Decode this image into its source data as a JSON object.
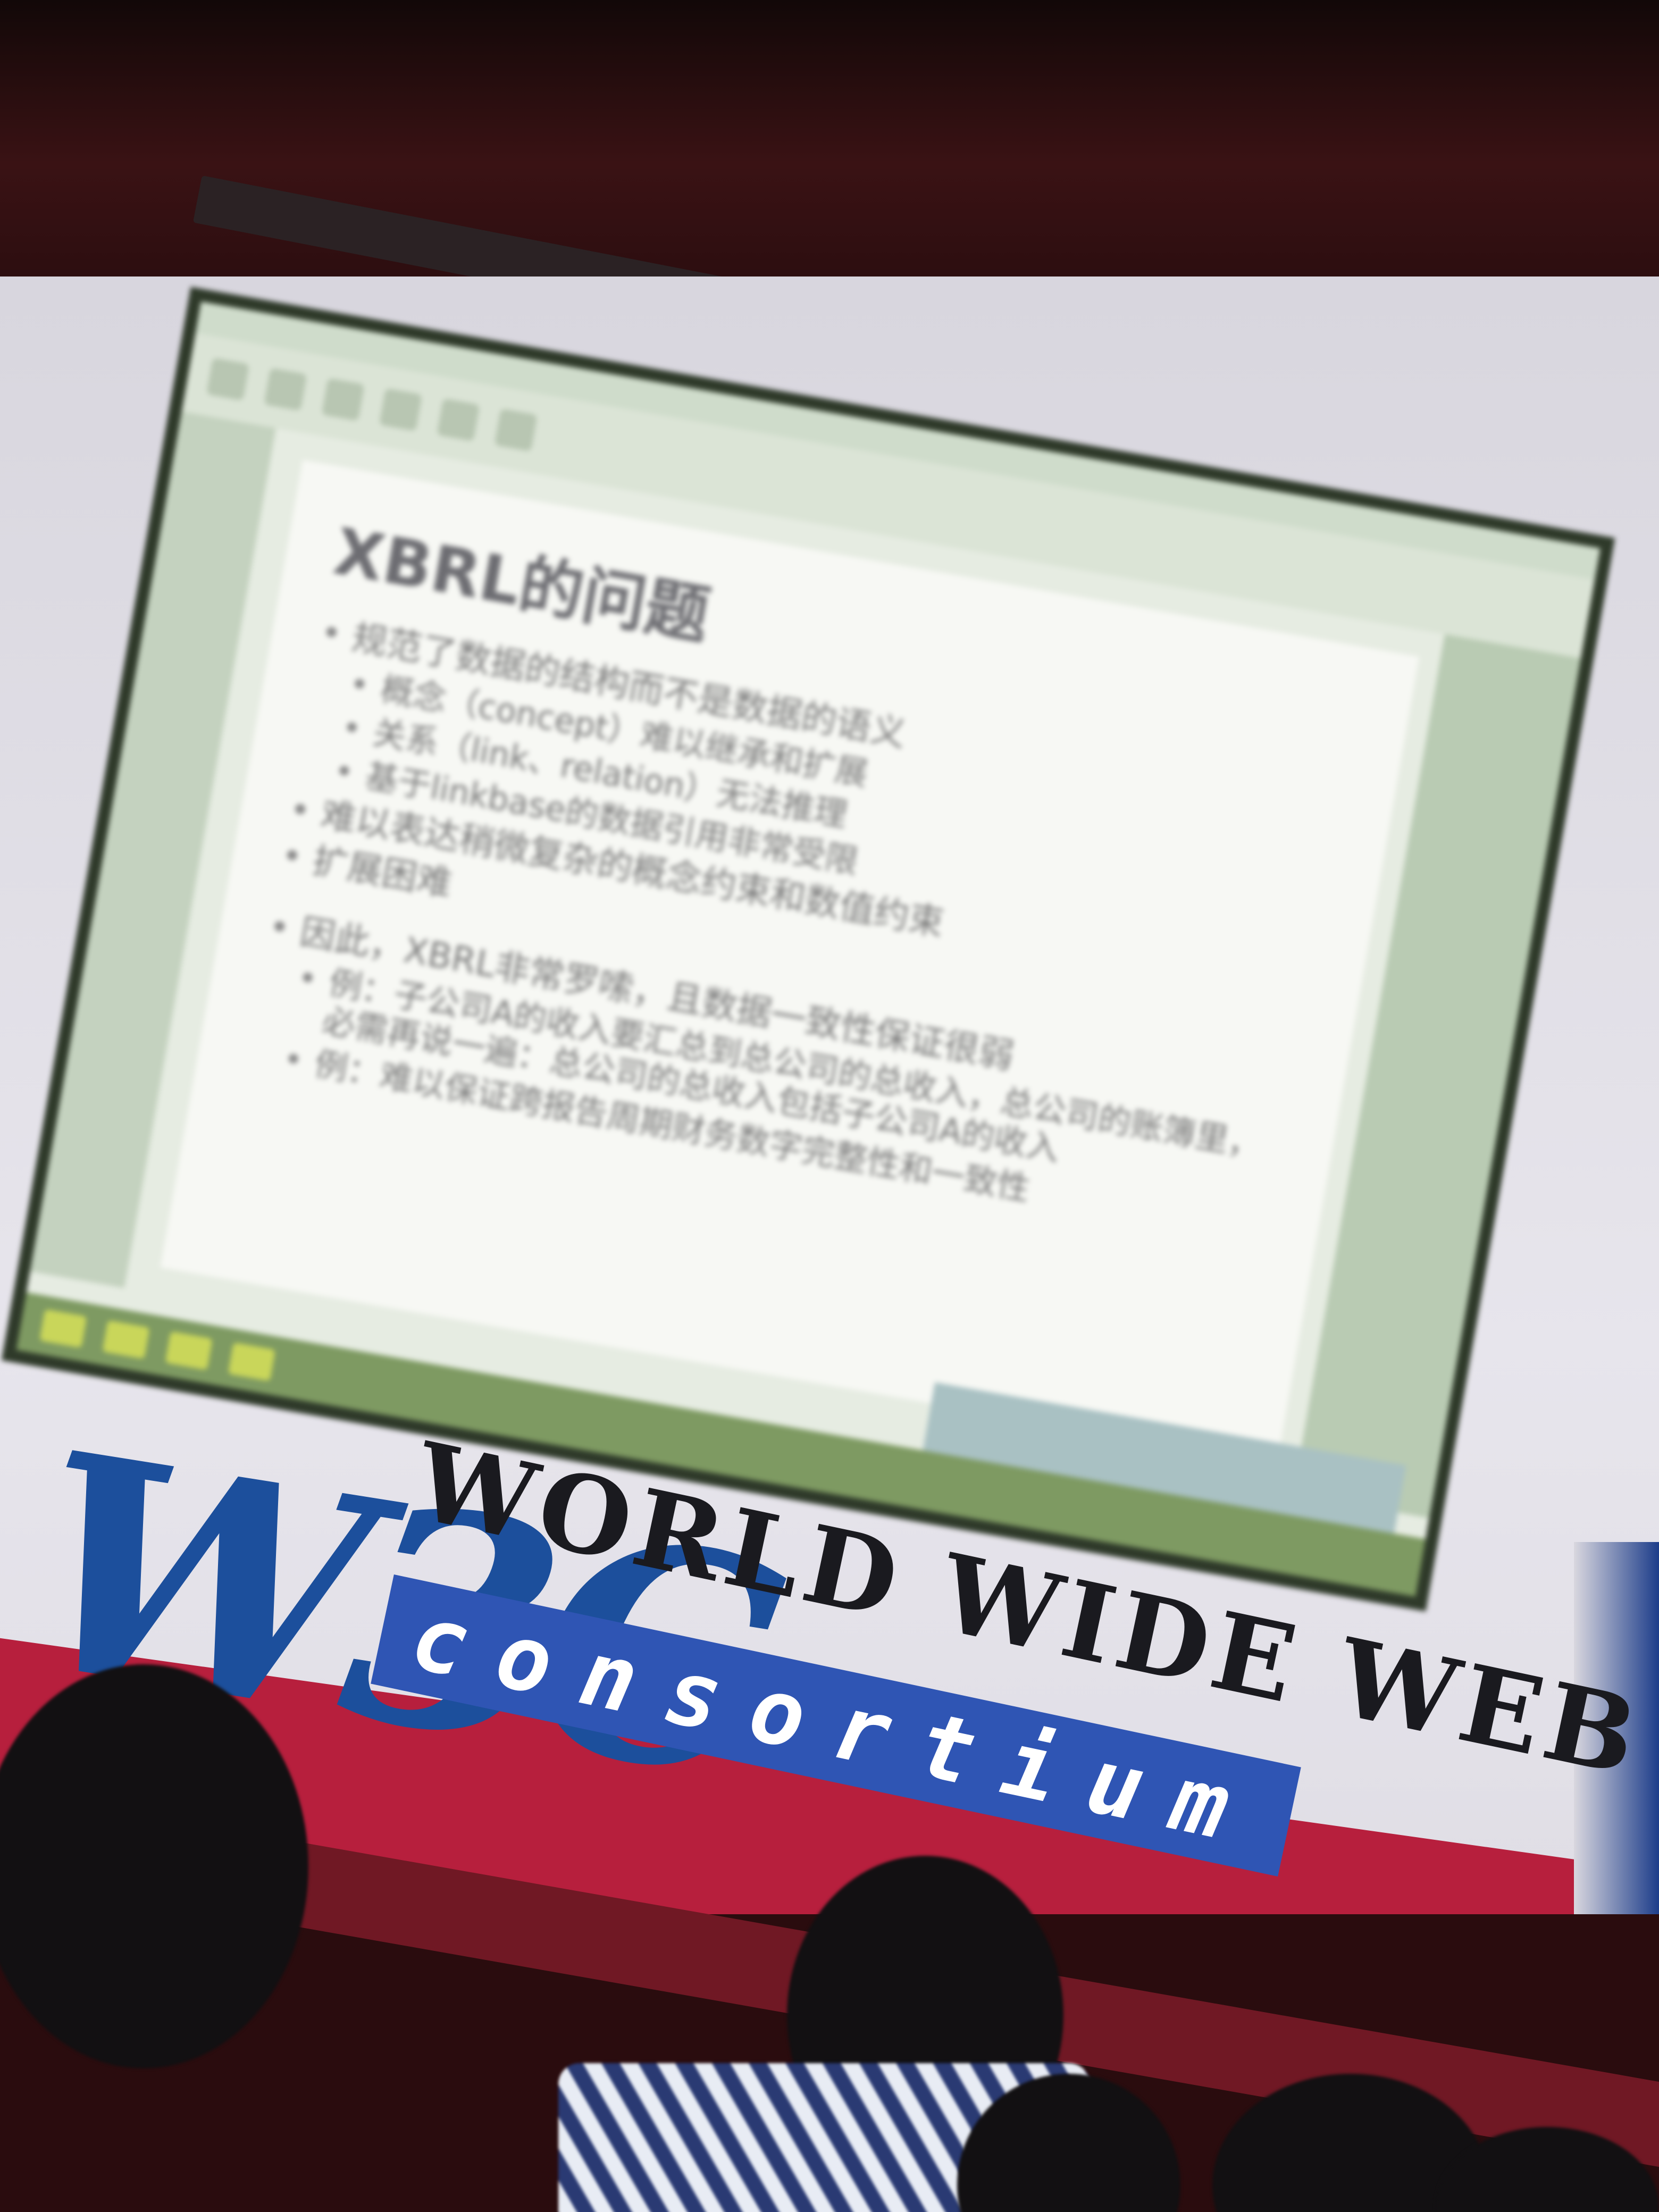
{
  "slide": {
    "title": "XBRL的问题",
    "bullets": [
      {
        "level": 1,
        "text": "规范了数据的结构而不是数据的语义"
      },
      {
        "level": 2,
        "text": "概念（concept）难以继承和扩展"
      },
      {
        "level": 2,
        "text": "关系（link、relation）无法推理"
      },
      {
        "level": 2,
        "text": "基于linkbase的数据引用非常受限"
      },
      {
        "level": 1,
        "text": "难以表达稍微复杂的概念约束和数值约束"
      },
      {
        "level": 1,
        "text": "扩展困难"
      },
      {
        "level": 1,
        "text": "因此，XBRL非常罗嗦，且数据一致性保证很弱"
      },
      {
        "level": 2,
        "text": "例：子公司A的收入要汇总到总公司的总收入，总公司的账簿里，必需再说一遍：总公司的总收入包括子公司A的收入"
      },
      {
        "level": 2,
        "text": "例：难以保证跨报告周期财务数字完整性和一致性"
      }
    ]
  },
  "banner": {
    "logo_text": "W3C",
    "name_text": "WORLD WIDE WEB",
    "sub_text": "consortium"
  },
  "colors": {
    "w3c_blue": "#1c4f9c",
    "banner_blue": "#2f55b4",
    "stage_red": "#b71f3d"
  }
}
